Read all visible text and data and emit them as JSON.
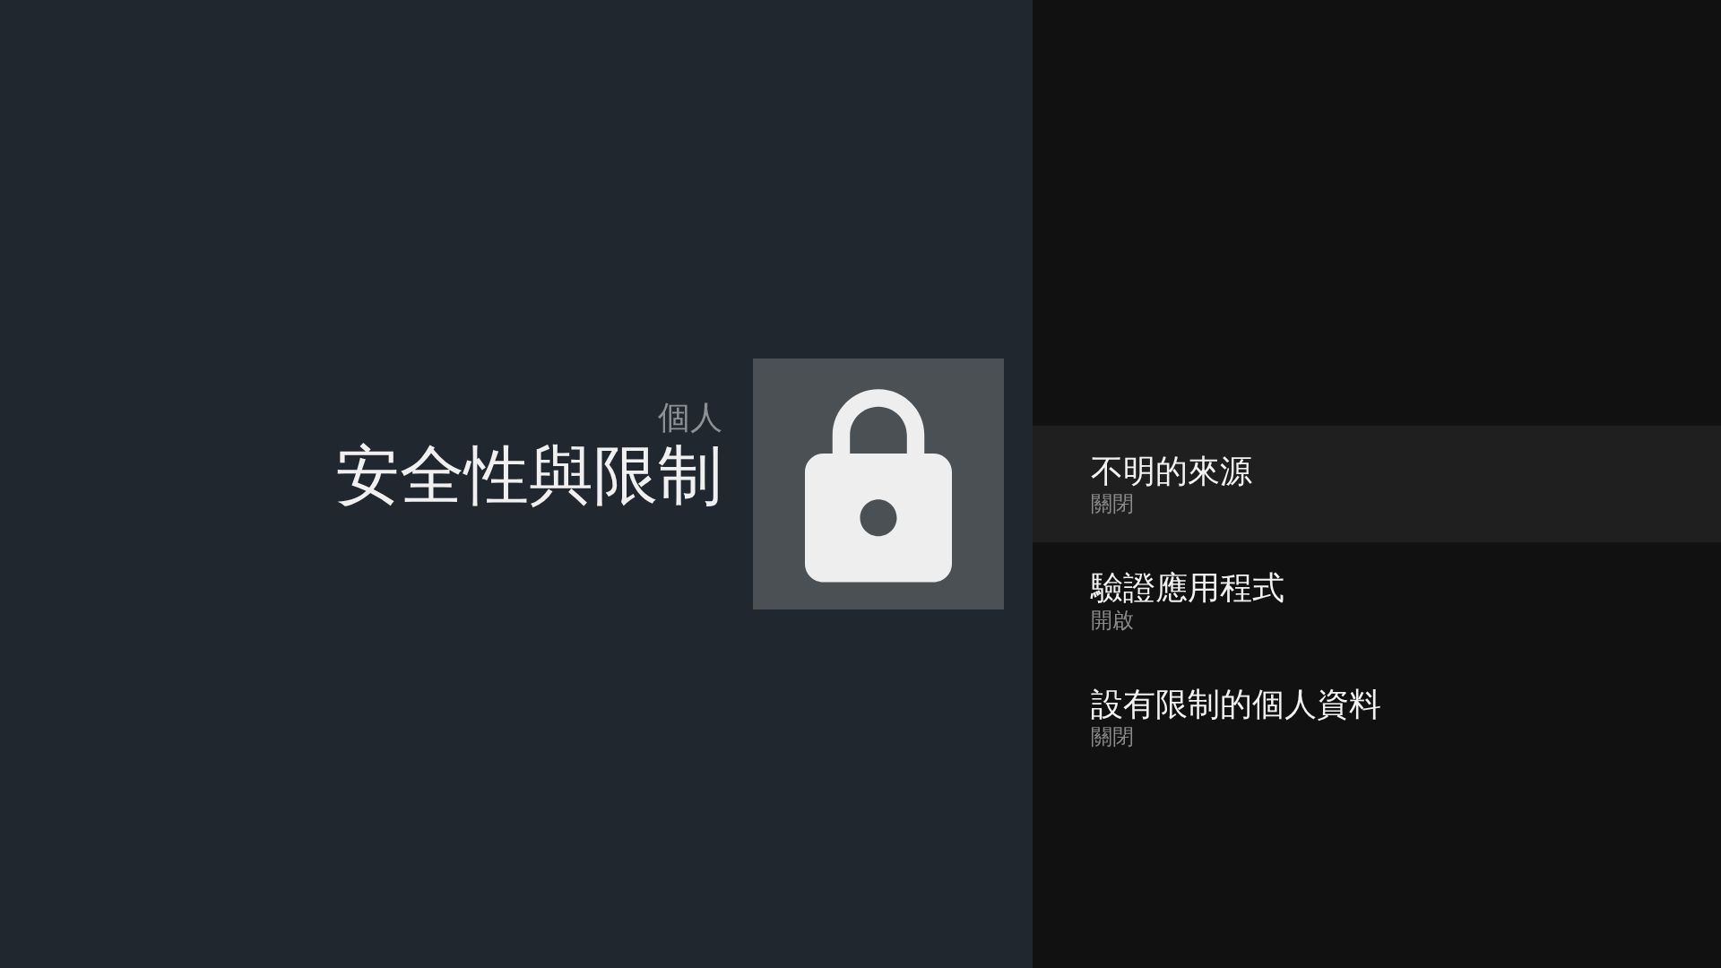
{
  "header": {
    "category": "個人",
    "title": "安全性與限制"
  },
  "settings": [
    {
      "title": "不明的來源",
      "value": "關閉",
      "selected": true
    },
    {
      "title": "驗證應用程式",
      "value": "開啟",
      "selected": false
    },
    {
      "title": "設有限制的個人資料",
      "value": "關閉",
      "selected": false
    }
  ]
}
